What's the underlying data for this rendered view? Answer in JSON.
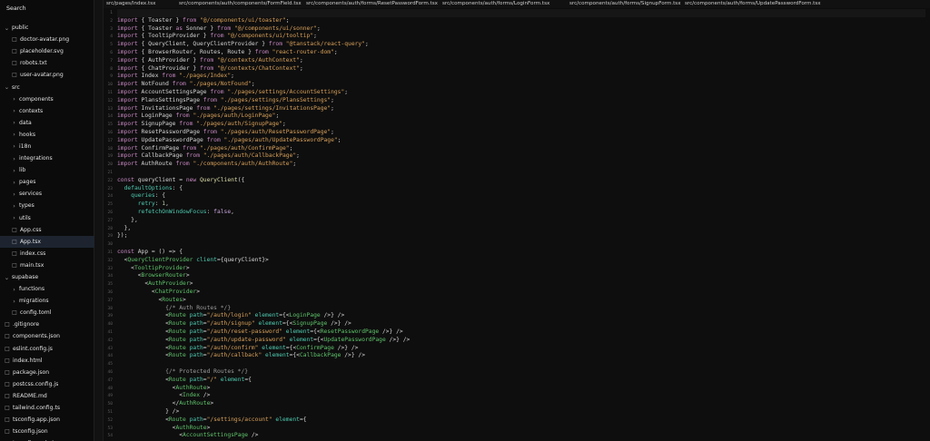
{
  "sidebar": {
    "search_label": "Search",
    "items": [
      {
        "label": "public",
        "kind": "folder",
        "open": true,
        "depth": 0
      },
      {
        "label": "doctor-avatar.png",
        "kind": "file",
        "depth": 1
      },
      {
        "label": "placeholder.svg",
        "kind": "file",
        "depth": 1
      },
      {
        "label": "robots.txt",
        "kind": "file",
        "depth": 1
      },
      {
        "label": "user-avatar.png",
        "kind": "file",
        "depth": 1
      },
      {
        "label": "src",
        "kind": "folder",
        "open": true,
        "depth": 0
      },
      {
        "label": "components",
        "kind": "folder",
        "open": false,
        "depth": 1
      },
      {
        "label": "contexts",
        "kind": "folder",
        "open": false,
        "depth": 1
      },
      {
        "label": "data",
        "kind": "folder",
        "open": false,
        "depth": 1
      },
      {
        "label": "hooks",
        "kind": "folder",
        "open": false,
        "depth": 1
      },
      {
        "label": "i18n",
        "kind": "folder",
        "open": false,
        "depth": 1
      },
      {
        "label": "integrations",
        "kind": "folder",
        "open": false,
        "depth": 1
      },
      {
        "label": "lib",
        "kind": "folder",
        "open": false,
        "depth": 1
      },
      {
        "label": "pages",
        "kind": "folder",
        "open": false,
        "depth": 1
      },
      {
        "label": "services",
        "kind": "folder",
        "open": false,
        "depth": 1
      },
      {
        "label": "types",
        "kind": "folder",
        "open": false,
        "depth": 1
      },
      {
        "label": "utils",
        "kind": "folder",
        "open": false,
        "depth": 1
      },
      {
        "label": "App.css",
        "kind": "file",
        "depth": 1
      },
      {
        "label": "App.tsx",
        "kind": "file",
        "depth": 1,
        "selected": true
      },
      {
        "label": "index.css",
        "kind": "file",
        "depth": 1
      },
      {
        "label": "main.tsx",
        "kind": "file",
        "depth": 1
      },
      {
        "label": "supabase",
        "kind": "folder",
        "open": true,
        "depth": 0
      },
      {
        "label": "functions",
        "kind": "folder",
        "open": false,
        "depth": 1
      },
      {
        "label": "migrations",
        "kind": "folder",
        "open": false,
        "depth": 1
      },
      {
        "label": "config.toml",
        "kind": "file",
        "depth": 1
      },
      {
        "label": ".gitignore",
        "kind": "file",
        "depth": 0
      },
      {
        "label": "components.json",
        "kind": "file",
        "depth": 0
      },
      {
        "label": "eslint.config.js",
        "kind": "file",
        "depth": 0
      },
      {
        "label": "index.html",
        "kind": "file",
        "depth": 0
      },
      {
        "label": "package.json",
        "kind": "file",
        "depth": 0
      },
      {
        "label": "postcss.config.js",
        "kind": "file",
        "depth": 0
      },
      {
        "label": "README.md",
        "kind": "file",
        "depth": 0
      },
      {
        "label": "tailwind.config.ts",
        "kind": "file",
        "depth": 0
      },
      {
        "label": "tsconfig.app.json",
        "kind": "file",
        "depth": 0
      },
      {
        "label": "tsconfig.json",
        "kind": "file",
        "depth": 0
      },
      {
        "label": "tsconfig.node.json",
        "kind": "file",
        "depth": 0
      }
    ]
  },
  "tabs": [
    "src/pages/Index.tsx",
    "src/components/auth/components/FormField.tsx",
    "src/components/auth/forms/ResetPasswordForm.tsx",
    "src/components/auth/forms/LoginForm.tsx",
    "src/components/auth/forms/SignupForm.tsx",
    "src/components/auth/forms/UpdatePasswordForm.tsx"
  ],
  "editor": {
    "active_line": 1,
    "lines": [
      [
        [
          "",
          "p"
        ]
      ],
      [
        [
          "import ",
          "k"
        ],
        [
          "{ Toaster } ",
          "p"
        ],
        [
          "from ",
          "k"
        ],
        [
          "\"@/components/ui/toaster\"",
          "s"
        ],
        [
          ";",
          "p"
        ]
      ],
      [
        [
          "import ",
          "k"
        ],
        [
          "{ Toaster ",
          "p"
        ],
        [
          "as ",
          "k"
        ],
        [
          "Sonner } ",
          "p"
        ],
        [
          "from ",
          "k"
        ],
        [
          "\"@/components/ui/sonner\"",
          "s"
        ],
        [
          ";",
          "p"
        ]
      ],
      [
        [
          "import ",
          "k"
        ],
        [
          "{ TooltipProvider } ",
          "p"
        ],
        [
          "from ",
          "k"
        ],
        [
          "\"@/components/ui/tooltip\"",
          "s"
        ],
        [
          ";",
          "p"
        ]
      ],
      [
        [
          "import ",
          "k"
        ],
        [
          "{ QueryClient, QueryClientProvider } ",
          "p"
        ],
        [
          "from ",
          "k"
        ],
        [
          "\"@tanstack/react-query\"",
          "s"
        ],
        [
          ";",
          "p"
        ]
      ],
      [
        [
          "import ",
          "k"
        ],
        [
          "{ BrowserRouter, Routes, Route } ",
          "p"
        ],
        [
          "from ",
          "k"
        ],
        [
          "\"react-router-dom\"",
          "s"
        ],
        [
          ";",
          "p"
        ]
      ],
      [
        [
          "import ",
          "k"
        ],
        [
          "{ AuthProvider } ",
          "p"
        ],
        [
          "from ",
          "k"
        ],
        [
          "\"@/contexts/AuthContext\"",
          "s"
        ],
        [
          ";",
          "p"
        ]
      ],
      [
        [
          "import ",
          "k"
        ],
        [
          "{ ChatProvider } ",
          "p"
        ],
        [
          "from ",
          "k"
        ],
        [
          "\"@/contexts/ChatContext\"",
          "s"
        ],
        [
          ";",
          "p"
        ]
      ],
      [
        [
          "import ",
          "k"
        ],
        [
          "Index ",
          "p"
        ],
        [
          "from ",
          "k"
        ],
        [
          "\"./pages/Index\"",
          "s"
        ],
        [
          ";",
          "p"
        ]
      ],
      [
        [
          "import ",
          "k"
        ],
        [
          "NotFound ",
          "p"
        ],
        [
          "from ",
          "k"
        ],
        [
          "\"./pages/NotFound\"",
          "s"
        ],
        [
          ";",
          "p"
        ]
      ],
      [
        [
          "import ",
          "k"
        ],
        [
          "AccountSettingsPage ",
          "p"
        ],
        [
          "from ",
          "k"
        ],
        [
          "\"./pages/settings/AccountSettings\"",
          "s"
        ],
        [
          ";",
          "p"
        ]
      ],
      [
        [
          "import ",
          "k"
        ],
        [
          "PlansSettingsPage ",
          "p"
        ],
        [
          "from ",
          "k"
        ],
        [
          "\"./pages/settings/PlansSettings\"",
          "s"
        ],
        [
          ";",
          "p"
        ]
      ],
      [
        [
          "import ",
          "k"
        ],
        [
          "InvitationsPage ",
          "p"
        ],
        [
          "from ",
          "k"
        ],
        [
          "\"./pages/settings/InvitationsPage\"",
          "s"
        ],
        [
          ";",
          "p"
        ]
      ],
      [
        [
          "import ",
          "k"
        ],
        [
          "LoginPage ",
          "p"
        ],
        [
          "from ",
          "k"
        ],
        [
          "\"./pages/auth/LoginPage\"",
          "s"
        ],
        [
          ";",
          "p"
        ]
      ],
      [
        [
          "import ",
          "k"
        ],
        [
          "SignupPage ",
          "p"
        ],
        [
          "from ",
          "k"
        ],
        [
          "\"./pages/auth/SignupPage\"",
          "s"
        ],
        [
          ";",
          "p"
        ]
      ],
      [
        [
          "import ",
          "k"
        ],
        [
          "ResetPasswordPage ",
          "p"
        ],
        [
          "from ",
          "k"
        ],
        [
          "\"./pages/auth/ResetPasswordPage\"",
          "s"
        ],
        [
          ";",
          "p"
        ]
      ],
      [
        [
          "import ",
          "k"
        ],
        [
          "UpdatePasswordPage ",
          "p"
        ],
        [
          "from ",
          "k"
        ],
        [
          "\"./pages/auth/UpdatePasswordPage\"",
          "s"
        ],
        [
          ";",
          "p"
        ]
      ],
      [
        [
          "import ",
          "k"
        ],
        [
          "ConfirmPage ",
          "p"
        ],
        [
          "from ",
          "k"
        ],
        [
          "\"./pages/auth/ConfirmPage\"",
          "s"
        ],
        [
          ";",
          "p"
        ]
      ],
      [
        [
          "import ",
          "k"
        ],
        [
          "CallbackPage ",
          "p"
        ],
        [
          "from ",
          "k"
        ],
        [
          "\"./pages/auth/CallbackPage\"",
          "s"
        ],
        [
          ";",
          "p"
        ]
      ],
      [
        [
          "import ",
          "k"
        ],
        [
          "AuthRoute ",
          "p"
        ],
        [
          "from ",
          "k"
        ],
        [
          "\"./components/auth/AuthRoute\"",
          "s"
        ],
        [
          ";",
          "p"
        ]
      ],
      [
        [
          "",
          "p"
        ]
      ],
      [
        [
          "const ",
          "k"
        ],
        [
          "queryClient = ",
          "p"
        ],
        [
          "new ",
          "k"
        ],
        [
          "QueryClient",
          "f"
        ],
        [
          "({",
          "p"
        ]
      ],
      [
        [
          "  defaultOptions",
          "a"
        ],
        [
          ": {",
          "p"
        ]
      ],
      [
        [
          "    queries",
          "a"
        ],
        [
          ": {",
          "p"
        ]
      ],
      [
        [
          "      retry",
          "a"
        ],
        [
          ": ",
          "p"
        ],
        [
          "1",
          "n"
        ],
        [
          ",",
          "p"
        ]
      ],
      [
        [
          "      refetchOnWindowFocus",
          "a"
        ],
        [
          ": ",
          "p"
        ],
        [
          "false",
          "o"
        ],
        [
          ",",
          "p"
        ]
      ],
      [
        [
          "    },",
          "p"
        ]
      ],
      [
        [
          "  },",
          "p"
        ]
      ],
      [
        [
          "});",
          "p"
        ]
      ],
      [
        [
          "",
          "p"
        ]
      ],
      [
        [
          "const ",
          "k"
        ],
        [
          "App = () => {",
          "p"
        ]
      ],
      [
        [
          "  <",
          "p"
        ],
        [
          "QueryClientProvider ",
          "t"
        ],
        [
          "client",
          "a"
        ],
        [
          "={queryClient}>",
          "p"
        ]
      ],
      [
        [
          "    <",
          "p"
        ],
        [
          "TooltipProvider",
          "t"
        ],
        [
          ">",
          "p"
        ]
      ],
      [
        [
          "      <",
          "p"
        ],
        [
          "BrowserRouter",
          "t"
        ],
        [
          ">",
          "p"
        ]
      ],
      [
        [
          "        <",
          "p"
        ],
        [
          "AuthProvider",
          "t"
        ],
        [
          ">",
          "p"
        ]
      ],
      [
        [
          "          <",
          "p"
        ],
        [
          "ChatProvider",
          "t"
        ],
        [
          ">",
          "p"
        ]
      ],
      [
        [
          "            <",
          "p"
        ],
        [
          "Routes",
          "t"
        ],
        [
          ">",
          "p"
        ]
      ],
      [
        [
          "              {/* Auth Routes */}",
          "c"
        ]
      ],
      [
        [
          "              <",
          "p"
        ],
        [
          "Route ",
          "t"
        ],
        [
          "path",
          "a"
        ],
        [
          "=",
          "p"
        ],
        [
          "\"/auth/login\" ",
          "s"
        ],
        [
          "element",
          "a"
        ],
        [
          "={<",
          "p"
        ],
        [
          "LoginPage",
          "t"
        ],
        [
          " />} />",
          "p"
        ]
      ],
      [
        [
          "              <",
          "p"
        ],
        [
          "Route ",
          "t"
        ],
        [
          "path",
          "a"
        ],
        [
          "=",
          "p"
        ],
        [
          "\"/auth/signup\" ",
          "s"
        ],
        [
          "element",
          "a"
        ],
        [
          "={<",
          "p"
        ],
        [
          "SignupPage",
          "t"
        ],
        [
          " />} />",
          "p"
        ]
      ],
      [
        [
          "              <",
          "p"
        ],
        [
          "Route ",
          "t"
        ],
        [
          "path",
          "a"
        ],
        [
          "=",
          "p"
        ],
        [
          "\"/auth/reset-password\" ",
          "s"
        ],
        [
          "element",
          "a"
        ],
        [
          "={<",
          "p"
        ],
        [
          "ResetPasswordPage",
          "t"
        ],
        [
          " />} />",
          "p"
        ]
      ],
      [
        [
          "              <",
          "p"
        ],
        [
          "Route ",
          "t"
        ],
        [
          "path",
          "a"
        ],
        [
          "=",
          "p"
        ],
        [
          "\"/auth/update-password\" ",
          "s"
        ],
        [
          "element",
          "a"
        ],
        [
          "={<",
          "p"
        ],
        [
          "UpdatePasswordPage",
          "t"
        ],
        [
          " />} />",
          "p"
        ]
      ],
      [
        [
          "              <",
          "p"
        ],
        [
          "Route ",
          "t"
        ],
        [
          "path",
          "a"
        ],
        [
          "=",
          "p"
        ],
        [
          "\"/auth/confirm\" ",
          "s"
        ],
        [
          "element",
          "a"
        ],
        [
          "={<",
          "p"
        ],
        [
          "ConfirmPage",
          "t"
        ],
        [
          " />} />",
          "p"
        ]
      ],
      [
        [
          "              <",
          "p"
        ],
        [
          "Route ",
          "t"
        ],
        [
          "path",
          "a"
        ],
        [
          "=",
          "p"
        ],
        [
          "\"/auth/callback\" ",
          "s"
        ],
        [
          "element",
          "a"
        ],
        [
          "={<",
          "p"
        ],
        [
          "CallbackPage",
          "t"
        ],
        [
          " />} />",
          "p"
        ]
      ],
      [
        [
          "",
          "p"
        ]
      ],
      [
        [
          "              {/* Protected Routes */}",
          "c"
        ]
      ],
      [
        [
          "              <",
          "p"
        ],
        [
          "Route ",
          "t"
        ],
        [
          "path",
          "a"
        ],
        [
          "=",
          "p"
        ],
        [
          "\"/\" ",
          "s"
        ],
        [
          "element",
          "a"
        ],
        [
          "={",
          "p"
        ]
      ],
      [
        [
          "                <",
          "p"
        ],
        [
          "AuthRoute",
          "t"
        ],
        [
          ">",
          "p"
        ]
      ],
      [
        [
          "                  <",
          "p"
        ],
        [
          "Index",
          "t"
        ],
        [
          " />",
          "p"
        ]
      ],
      [
        [
          "                </",
          "p"
        ],
        [
          "AuthRoute",
          "t"
        ],
        [
          ">",
          "p"
        ]
      ],
      [
        [
          "              } />",
          "p"
        ]
      ],
      [
        [
          "              <",
          "p"
        ],
        [
          "Route ",
          "t"
        ],
        [
          "path",
          "a"
        ],
        [
          "=",
          "p"
        ],
        [
          "\"/settings/account\" ",
          "s"
        ],
        [
          "element",
          "a"
        ],
        [
          "={",
          "p"
        ]
      ],
      [
        [
          "                <",
          "p"
        ],
        [
          "AuthRoute",
          "t"
        ],
        [
          ">",
          "p"
        ]
      ],
      [
        [
          "                  <",
          "p"
        ],
        [
          "AccountSettingsPage",
          "t"
        ],
        [
          " />",
          "p"
        ]
      ]
    ]
  }
}
